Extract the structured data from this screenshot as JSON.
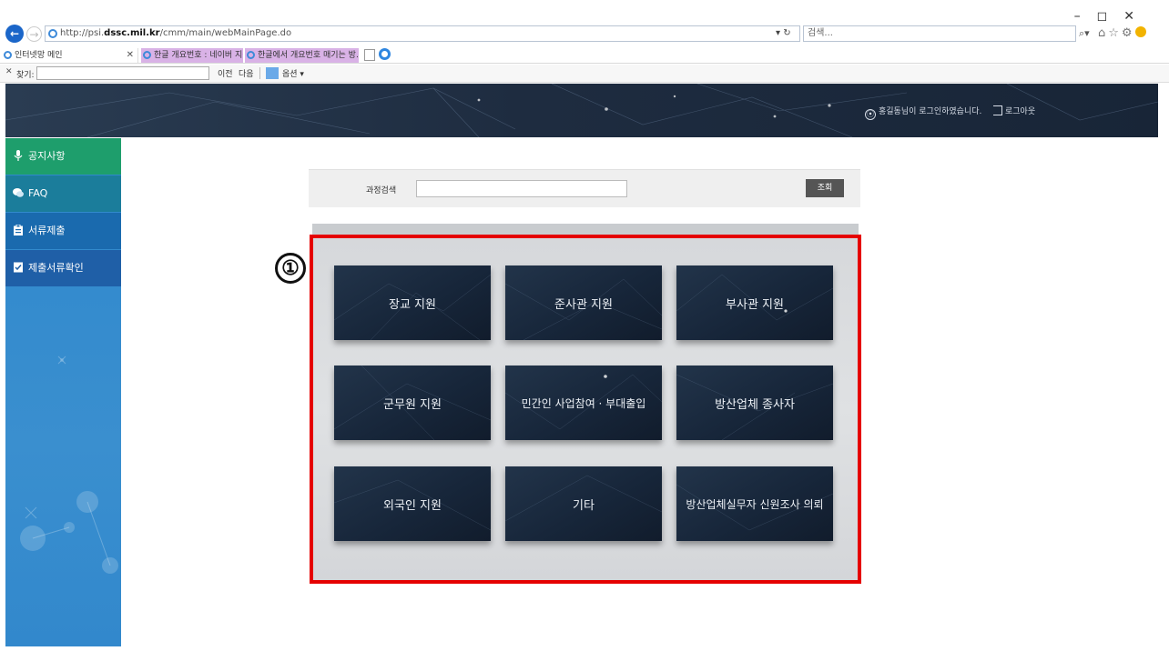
{
  "browser": {
    "address_prefix": "http://psi.",
    "address_domain": "dssc.mil.kr",
    "address_path": "/cmm/main/webMainPage.do",
    "address_tools": "▾ ↻",
    "search_placeholder": "검색...",
    "search_go": "⌕▾",
    "window_controls": "–◻✕",
    "tabs": [
      {
        "label": "인터넷망 메인",
        "close": "✕"
      },
      {
        "label": "한글 개요번호 : 네이버 지식iN..."
      },
      {
        "label": "한글에서 개요번호 매기는 방..."
      }
    ],
    "find": {
      "close": "✕",
      "label": "찾기:",
      "prev": "이전",
      "next": "다음",
      "options": "옵션 ▾"
    },
    "right_icons": "⌂☆⚙"
  },
  "header": {
    "login_status": "홍길동님이 로그인하였습니다.",
    "logout_label": "로그아웃"
  },
  "sidebar": {
    "items": [
      {
        "label": "공지사항",
        "color": "#1e9e6c"
      },
      {
        "label": "FAQ",
        "color": "#1b7d9b"
      },
      {
        "label": "서류제출",
        "color": "#1a6aae"
      },
      {
        "label": "제출서류확인",
        "color": "#1f5fa7"
      }
    ]
  },
  "search": {
    "label": "과정검색",
    "value": "",
    "button_label": "조회"
  },
  "annotation": {
    "marker": "①",
    "color": "#e50000"
  },
  "tiles": [
    {
      "label": "장교 지원"
    },
    {
      "label": "준사관 지원"
    },
    {
      "label": "부사관 지원"
    },
    {
      "label": "군무원 지원"
    },
    {
      "label": "민간인 사업참여 · 부대출입"
    },
    {
      "label": "방산업체 종사자"
    },
    {
      "label": "외국인 지원"
    },
    {
      "label": "기타"
    },
    {
      "label": "방산업체실무자 신원조사 의뢰"
    }
  ]
}
